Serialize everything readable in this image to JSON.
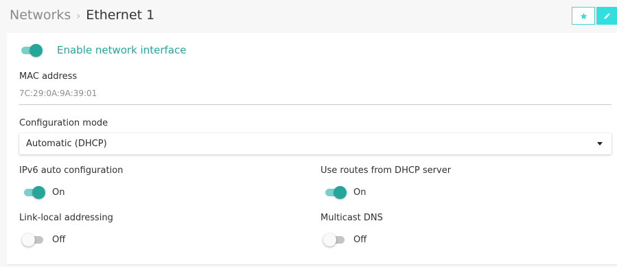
{
  "header": {
    "parent": "Networks",
    "separator": "›",
    "current": "Ethernet 1"
  },
  "actions": {
    "favorite_icon": "star-icon",
    "edit_icon": "pencil-icon",
    "accent": "#33dede"
  },
  "interface": {
    "enable_label": "Enable network interface",
    "enabled": true
  },
  "mac": {
    "label": "MAC address",
    "value": "7C:29:0A:9A:39:01"
  },
  "config": {
    "label": "Configuration mode",
    "selected": "Automatic (DHCP)"
  },
  "settings": {
    "ipv6": {
      "label": "IPv6 auto configuration",
      "state": "On",
      "enabled": true
    },
    "routes": {
      "label": "Use routes from DHCP server",
      "state": "On",
      "enabled": true
    },
    "link_local": {
      "label": "Link-local addressing",
      "state": "Off",
      "enabled": false
    },
    "mdns": {
      "label": "Multicast DNS",
      "state": "Off",
      "enabled": false
    }
  },
  "colors": {
    "toggle_on": "#26a69a",
    "toggle_on_track": "#78d0ca",
    "toggle_off_track": "#c4c4c4"
  }
}
